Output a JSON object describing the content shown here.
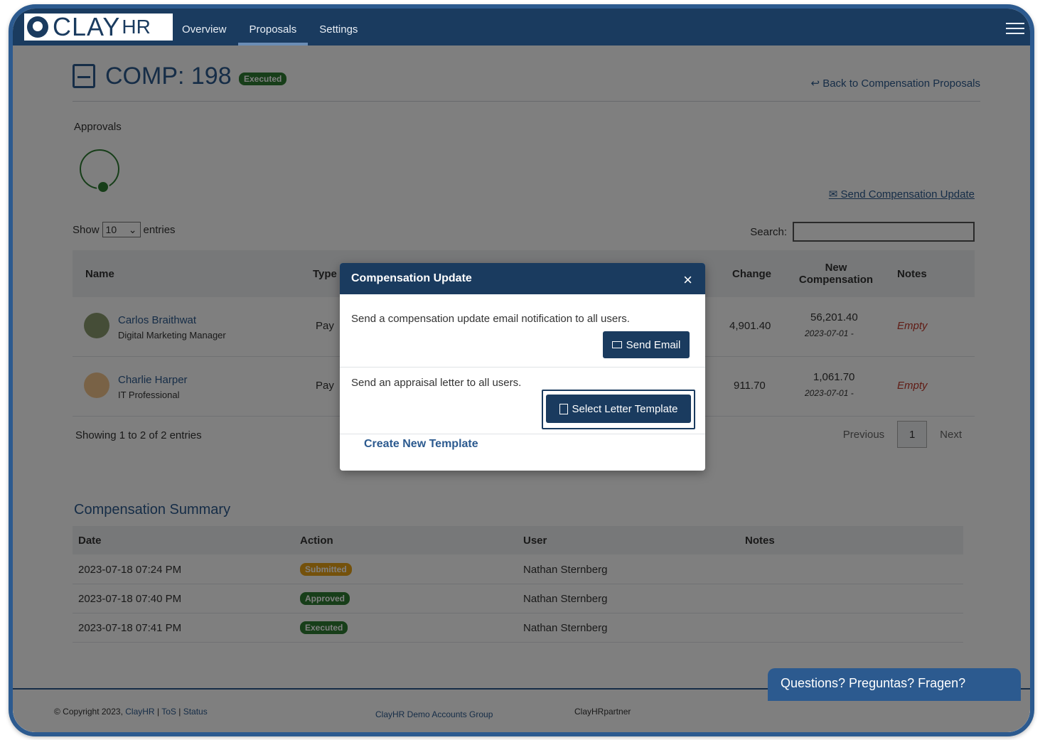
{
  "app": {
    "logo_clay": "CLAY",
    "logo_hr": "HR"
  },
  "nav": {
    "items": [
      "Overview",
      "Proposals",
      "Settings"
    ],
    "active": "Proposals"
  },
  "header": {
    "title": "COMP: 198",
    "status": "Executed",
    "back_link": "Back to Compensation Proposals"
  },
  "approvals": {
    "label": "Approvals"
  },
  "actions": {
    "send_update": "Send Compensation Update"
  },
  "table_controls": {
    "show": "Show",
    "page_size": "10",
    "entries": "entries",
    "search_label": "Search:",
    "search_value": ""
  },
  "table": {
    "headers": {
      "name": "Name",
      "type": "Type",
      "change": "Change",
      "new_comp": "New Compensation",
      "notes": "Notes"
    },
    "rows": [
      {
        "name": "Carlos Braithwat",
        "title": "Digital Marketing Manager",
        "type": "Pay",
        "change": "4,901.40",
        "new_comp": "56,201.40",
        "date": "2023-07-01 -",
        "notes": "Empty"
      },
      {
        "name": "Charlie Harper",
        "title": "IT Professional",
        "type": "Pay",
        "change": "911.70",
        "new_comp": "1,061.70",
        "date": "2023-07-01 -",
        "notes": "Empty"
      }
    ],
    "showing": "Showing 1 to 2 of 2 entries",
    "pager": {
      "previous": "Previous",
      "page": "1",
      "next": "Next"
    }
  },
  "summary": {
    "title": "Compensation Summary",
    "headers": {
      "date": "Date",
      "action": "Action",
      "user": "User",
      "notes": "Notes"
    },
    "rows": [
      {
        "date": "2023-07-18 07:24 PM",
        "action": "Submitted",
        "user": "Nathan Sternberg"
      },
      {
        "date": "2023-07-18 07:40 PM",
        "action": "Approved",
        "user": "Nathan Sternberg"
      },
      {
        "date": "2023-07-18 07:41 PM",
        "action": "Executed",
        "user": "Nathan Sternberg"
      }
    ]
  },
  "footer": {
    "copyright": "© Copyright 2023,",
    "clayhr": "ClayHR",
    "tos": "ToS",
    "status": "Status",
    "sep": "|",
    "group": "ClayHR Demo Accounts Group",
    "partner": "ClayHRpartner"
  },
  "chat": {
    "label": "Questions? Preguntas? Fragen?"
  },
  "modal": {
    "title": "Compensation Update",
    "close": "×",
    "email_text": "Send a compensation update email notification to all users.",
    "send_email": "Send Email",
    "letter_text": "Send an appraisal letter to all users.",
    "select_template": "Select Letter Template",
    "create_template": "Create New Template"
  },
  "colors": {
    "brand": "#1a3b5f",
    "link": "#2c5a8f",
    "success": "#2e7d32",
    "warning": "#e8a317",
    "empty": "#c0392b"
  }
}
